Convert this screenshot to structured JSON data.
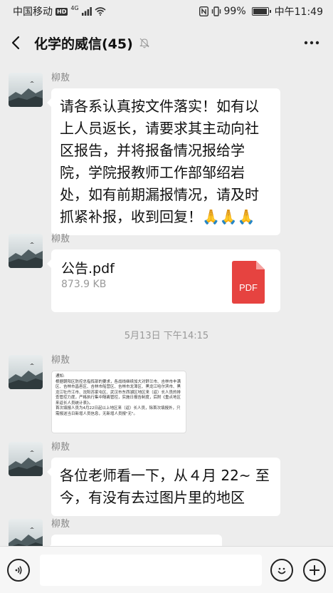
{
  "status_bar": {
    "carrier": "中国移动",
    "hd_badge": "HD",
    "network": "4G",
    "battery_percent": "99%",
    "battery_level": 0.99,
    "time": "中午11:49"
  },
  "header": {
    "title": "化学的威信(45)",
    "back_icon": "chevron-left-icon",
    "mute_icon": "bell-off-icon",
    "more_label": "···"
  },
  "messages": [
    {
      "sender": "柳敖",
      "type": "text",
      "text": "请各系认真按文件落实！如有以上人员返长，请要求其主动向社区报告，并将报备情况报给学院，学院报教师工作部邹绍岩处，如有前期漏报情况，请及时抓紧补报，收到回复！🙏🙏🙏"
    },
    {
      "sender": "柳敖",
      "type": "file",
      "file_name": "公告.pdf",
      "file_size": "873.9 KB",
      "file_badge": "PDF"
    },
    {
      "sender": "柳敖",
      "type": "image",
      "image_lines": [
        "通知:",
        "根据朝阳区防控总指挥部的要求，各战线继续加大对舒兰市、吉林市丰满区、吉林市昌邑区、吉林市船营区、吉林市龙潭区、黑龙江哈尔滨市、黑龙江牡丹江市、沈阳苏家屯区、武汉市东西湖区地区来（返）长人员的排查管控力度，严格执行集中隔离管控，实施日报告制度，后附《重点地区来返长人员统计表》。",
        "首次填报人员为4月22日起以上地区来（返）长人员，除首次填报外，只需报送当日新增人员信息，无新增人员报\"无\"。"
      ]
    },
    {
      "sender": "柳敖",
      "type": "text",
      "text": "各位老师看一下，从４月 22~ 至今，有没有去过图片里的地区"
    },
    {
      "sender": "柳敖",
      "type": "text",
      "text": ""
    }
  ],
  "timestamp": "5月13日 下午14:15",
  "input_bar": {
    "voice_icon": "voice-icon",
    "emoji_icon": "emoji-icon",
    "plus_icon": "plus-icon",
    "placeholder": ""
  },
  "colors": {
    "background": "#ededed",
    "bubble": "#ffffff",
    "pdf_red": "#e64340",
    "muted_text": "#888888"
  }
}
